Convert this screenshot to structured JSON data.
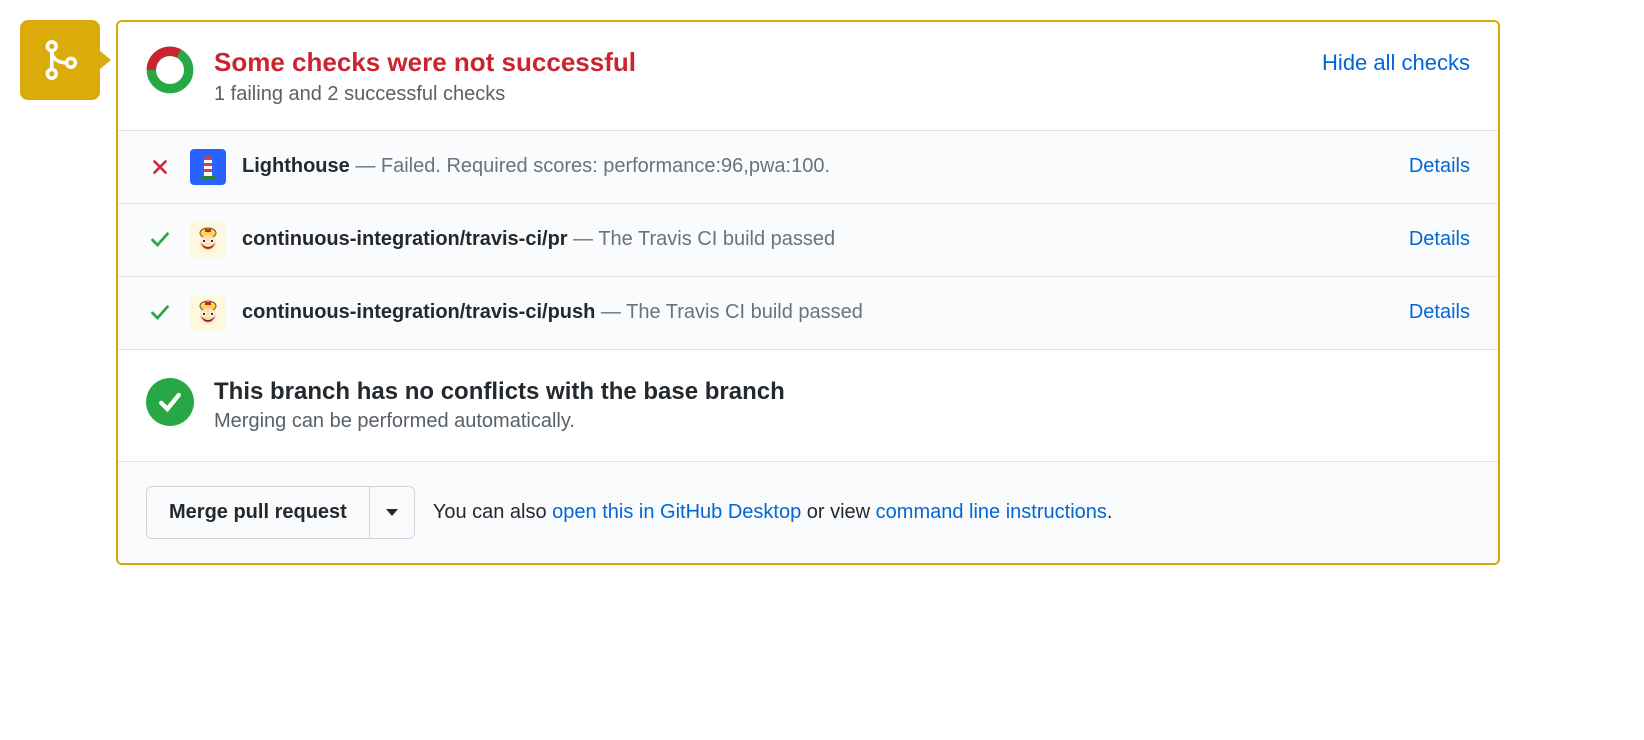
{
  "header": {
    "title": "Some checks were not successful",
    "subtitle": "1 failing and 2 successful checks",
    "toggle": "Hide all checks"
  },
  "checks": [
    {
      "status": "fail",
      "app": "Lighthouse",
      "name": "Lighthouse",
      "sep": " — ",
      "desc": "Failed. Required scores: performance:96,pwa:100.",
      "details": "Details"
    },
    {
      "status": "pass",
      "app": "Travis CI",
      "name": "continuous-integration/travis-ci/pr",
      "sep": " — ",
      "desc": "The Travis CI build passed",
      "details": "Details"
    },
    {
      "status": "pass",
      "app": "Travis CI",
      "name": "continuous-integration/travis-ci/push",
      "sep": " — ",
      "desc": "The Travis CI build passed",
      "details": "Details"
    }
  ],
  "conflict": {
    "title": "This branch has no conflicts with the base branch",
    "subtitle": "Merging can be performed automatically."
  },
  "merge": {
    "button": "Merge pull request",
    "hint_prefix": "You can also ",
    "desktop_link": "open this in GitHub Desktop",
    "hint_mid": " or view ",
    "cli_link": "command line instructions",
    "hint_suffix": "."
  }
}
